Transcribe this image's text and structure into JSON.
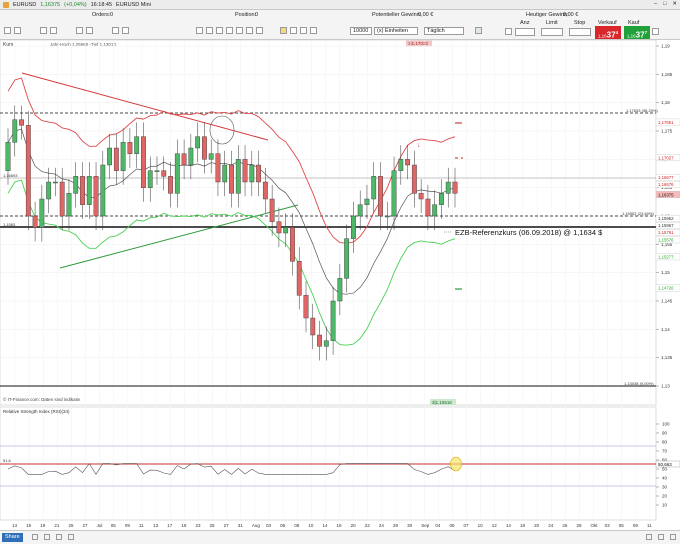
{
  "window": {
    "symbol_label": "EURUSD",
    "price": "1,16375",
    "change": "(+0,04%)",
    "time": "16:18:45",
    "title": "EURUSD Mini"
  },
  "toolbar": {
    "orders_label": "Orders:",
    "orders_value": "0",
    "position_label": "Position:",
    "position_value": "0",
    "pot_gain_label": "Potentieller Gewinn:",
    "pot_gain_value": "0,00 €",
    "today_gain_label": "Heutiger Gewinn:",
    "today_gain_value": "0,00 €",
    "qty_value": "10000",
    "unit_value": "(x) Einheiten",
    "validity_value": "Täglich",
    "col_anz": "Anz",
    "col_limit": "Limit",
    "col_stop": "Stop",
    "sell_label": "Verkauf",
    "buy_label": "Kauf",
    "sell_price": "1,16",
    "sell_big": "37",
    "sell_small": "4",
    "buy_price": "1,16",
    "buy_big": "37",
    "buy_small": "7"
  },
  "legend": {
    "kurs": "Kurs",
    "jahr_info": "Jahr-Hoch 1,25560 -Tief 1,13010",
    "top_marker": "3|1,17033",
    "bottom_marker": "3|1,15516",
    "copyright": "© IT-Finance.com: Daten sind indikativ",
    "rsi_title": "Relative Strength Index (RSI)(34)",
    "annotation": "EZB-Referenzkurs (06.09.2018) @ 1,1634 $"
  },
  "price_axis": [
    "1,19",
    "1,185",
    "1,18",
    "1,175",
    "1,17",
    "1,165",
    "1,16",
    "1,155",
    "1,15",
    "1,145",
    "1,14",
    "1,135",
    "1,13"
  ],
  "price_tags": {
    "fib_top": "1,17633 (38,20%)",
    "fib_mid": "1,15952 (23,60%)",
    "fib_low": "1,13038 (0,00%)",
    "left_level_1": "1,16693",
    "left_level_2": "1,1583",
    "t1": "1,17651",
    "t2": "1,17027",
    "t3": "1,16677",
    "t4": "1,16576",
    "t5": "1,16375",
    "t6": "1,15952",
    "t7": "1,15967",
    "t8": "1,15761",
    "t9": "1,15576",
    "t10": "1,15277",
    "t11": "1,14726"
  },
  "rsi": {
    "axis": [
      "100",
      "90",
      "80",
      "70",
      "60",
      "50",
      "40",
      "30",
      "20",
      "10"
    ],
    "left_value": "51,6",
    "current_value": "50,663"
  },
  "x_axis": [
    "13",
    "15",
    "19",
    "21",
    "25",
    "27",
    "Jul",
    "05",
    "09",
    "11",
    "13",
    "17",
    "19",
    "23",
    "25",
    "27",
    "31",
    "Aug",
    "03",
    "06",
    "08",
    "10",
    "14",
    "16",
    "20",
    "22",
    "24",
    "28",
    "30",
    "Sep",
    "04",
    "06",
    "07",
    "10",
    "12",
    "14",
    "18",
    "20",
    "24",
    "26",
    "28",
    "Okt",
    "03",
    "05",
    "09",
    "11"
  ],
  "bottom": {
    "share_label": "Share"
  },
  "chart_data": {
    "type": "candlestick",
    "x_range": [
      "13 Jun 2018",
      "12 Okt 2018"
    ],
    "ylim": [
      1.13,
      1.19
    ],
    "candles_close_approx": [
      1.173,
      1.177,
      1.176,
      1.16,
      1.158,
      1.163,
      1.166,
      1.166,
      1.16,
      1.164,
      1.167,
      1.162,
      1.167,
      1.16,
      1.169,
      1.172,
      1.168,
      1.173,
      1.171,
      1.174,
      1.165,
      1.168,
      1.168,
      1.167,
      1.164,
      1.171,
      1.169,
      1.172,
      1.174,
      1.17,
      1.171,
      1.166,
      1.169,
      1.164,
      1.17,
      1.166,
      1.169,
      1.166,
      1.163,
      1.159,
      1.157,
      1.158,
      1.152,
      1.146,
      1.142,
      1.139,
      1.137,
      1.138,
      1.145,
      1.149,
      1.156,
      1.16,
      1.162,
      1.163,
      1.167,
      1.16,
      1.16,
      1.168,
      1.17,
      1.169,
      1.164,
      1.163,
      1.16,
      1.162,
      1.164,
      1.166,
      1.164
    ],
    "rsi_value": 50.663
  }
}
